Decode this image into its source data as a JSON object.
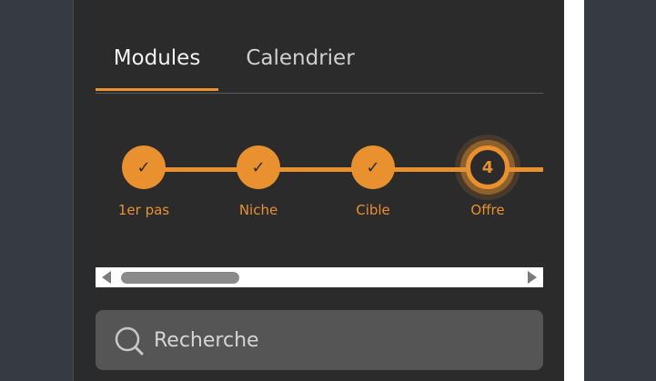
{
  "tabs": [
    {
      "label": "Modules",
      "active": true
    },
    {
      "label": "Calendrier",
      "active": false
    }
  ],
  "steps": [
    {
      "label": "1er pas",
      "status": "completed",
      "mark": "✓"
    },
    {
      "label": "Niche",
      "status": "completed",
      "mark": "✓"
    },
    {
      "label": "Cible",
      "status": "completed",
      "mark": "✓"
    },
    {
      "label": "Offre",
      "status": "current",
      "mark": "4"
    }
  ],
  "search": {
    "placeholder": "Recherche",
    "icon": "search-icon"
  },
  "colors": {
    "accent": "#e8912e",
    "panel": "#2b2b2b",
    "background": "#353a43",
    "search_field": "#555555"
  }
}
